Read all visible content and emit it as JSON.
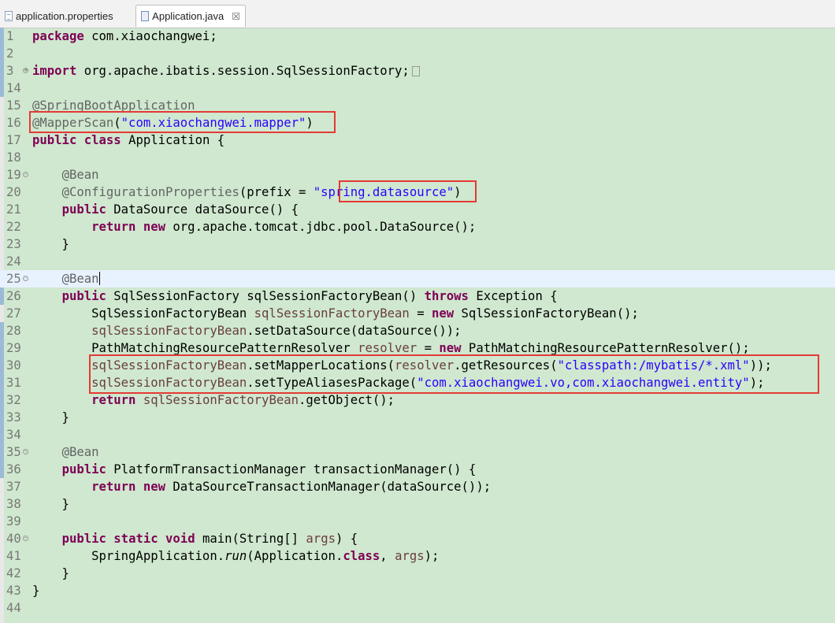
{
  "tabs": [
    {
      "label": "application.properties",
      "active": false
    },
    {
      "label": "Application.java",
      "active": true,
      "close": "☒"
    }
  ],
  "lines": [
    {
      "n": "1",
      "fold": "",
      "cur": false,
      "html": "<span class=\"kw\">package</span> com.xiaochangwei;"
    },
    {
      "n": "2",
      "fold": "",
      "cur": false,
      "html": ""
    },
    {
      "n": "3",
      "fold": "+",
      "cur": false,
      "html": "<span class=\"kw\">import</span> org.apache.ibatis.session.SqlSessionFactory;<span class=\"collapsed-box\"></span>"
    },
    {
      "n": "14",
      "fold": "",
      "cur": false,
      "html": ""
    },
    {
      "n": "15",
      "fold": "",
      "cur": false,
      "html": "<span class=\"ann\">@SpringBootApplication</span>"
    },
    {
      "n": "16",
      "fold": "",
      "cur": false,
      "html": "<span class=\"ann\">@MapperScan</span>(<span class=\"str\">\"com.xiaochangwei.mapper\"</span>)"
    },
    {
      "n": "17",
      "fold": "",
      "cur": false,
      "html": "<span class=\"kw\">public</span> <span class=\"kw\">class</span> Application {"
    },
    {
      "n": "18",
      "fold": "",
      "cur": false,
      "html": ""
    },
    {
      "n": "19",
      "fold": "-",
      "cur": false,
      "html": "    <span class=\"ann\">@Bean</span>"
    },
    {
      "n": "20",
      "fold": "",
      "cur": false,
      "html": "    <span class=\"ann\">@ConfigurationProperties</span>(prefix = <span class=\"str\">\"spring.datasource\"</span>)"
    },
    {
      "n": "21",
      "fold": "",
      "cur": false,
      "html": "    <span class=\"kw\">public</span> DataSource dataSource() {"
    },
    {
      "n": "22",
      "fold": "",
      "cur": false,
      "html": "        <span class=\"kw\">return</span> <span class=\"kw\">new</span> org.apache.tomcat.jdbc.pool.DataSource();"
    },
    {
      "n": "23",
      "fold": "",
      "cur": false,
      "html": "    }"
    },
    {
      "n": "24",
      "fold": "",
      "cur": false,
      "html": ""
    },
    {
      "n": "25",
      "fold": "-",
      "cur": true,
      "html": "    <span class=\"ann\">@Bean</span><span class=\"caret\"></span>"
    },
    {
      "n": "26",
      "fold": "",
      "cur": false,
      "html": "    <span class=\"kw\">public</span> SqlSessionFactory sqlSessionFactoryBean() <span class=\"kw\">throws</span> Exception {"
    },
    {
      "n": "27",
      "fold": "",
      "cur": false,
      "html": "        SqlSessionFactoryBean <span class=\"fld\">sqlSessionFactoryBean</span> = <span class=\"kw\">new</span> SqlSessionFactoryBean();"
    },
    {
      "n": "28",
      "fold": "",
      "cur": false,
      "html": "        <span class=\"fld\">sqlSessionFactoryBean</span>.setDataSource(dataSource());"
    },
    {
      "n": "29",
      "fold": "",
      "cur": false,
      "html": "        PathMatchingResourcePatternResolver <span class=\"fld\">resolver</span> = <span class=\"kw\">new</span> PathMatchingResourcePatternResolver();"
    },
    {
      "n": "30",
      "fold": "",
      "cur": false,
      "html": "        <span class=\"fld\">sqlSessionFactoryBean</span>.setMapperLocations(<span class=\"fld\">resolver</span>.getResources(<span class=\"str\">\"classpath:/mybatis/*.xml\"</span>));"
    },
    {
      "n": "31",
      "fold": "",
      "cur": false,
      "html": "        <span class=\"fld\">sqlSessionFactoryBean</span>.setTypeAliasesPackage(<span class=\"str\">\"com.xiaochangwei.vo,com.xiaochangwei.entity\"</span>);"
    },
    {
      "n": "32",
      "fold": "",
      "cur": false,
      "html": "        <span class=\"kw\">return</span> <span class=\"fld\">sqlSessionFactoryBean</span>.getObject();"
    },
    {
      "n": "33",
      "fold": "",
      "cur": false,
      "html": "    }"
    },
    {
      "n": "34",
      "fold": "",
      "cur": false,
      "html": ""
    },
    {
      "n": "35",
      "fold": "-",
      "cur": false,
      "html": "    <span class=\"ann\">@Bean</span>"
    },
    {
      "n": "36",
      "fold": "",
      "cur": false,
      "html": "    <span class=\"kw\">public</span> PlatformTransactionManager transactionManager() {"
    },
    {
      "n": "37",
      "fold": "",
      "cur": false,
      "html": "        <span class=\"kw\">return</span> <span class=\"kw\">new</span> DataSourceTransactionManager(dataSource());"
    },
    {
      "n": "38",
      "fold": "",
      "cur": false,
      "html": "    }"
    },
    {
      "n": "39",
      "fold": "",
      "cur": false,
      "html": ""
    },
    {
      "n": "40",
      "fold": "-",
      "cur": false,
      "html": "    <span class=\"kw\">public</span> <span class=\"kw\">static</span> <span class=\"kw\">void</span> main(String[] <span class=\"fld\">args</span>) {"
    },
    {
      "n": "41",
      "fold": "",
      "cur": false,
      "html": "        SpringApplication.<span class=\"it\">run</span>(Application.<span class=\"kw\">class</span>, <span class=\"fld\">args</span>);"
    },
    {
      "n": "42",
      "fold": "",
      "cur": false,
      "html": "    }"
    },
    {
      "n": "43",
      "fold": "",
      "cur": false,
      "html": "}"
    },
    {
      "n": "44",
      "fold": "",
      "cur": false,
      "html": ""
    }
  ]
}
